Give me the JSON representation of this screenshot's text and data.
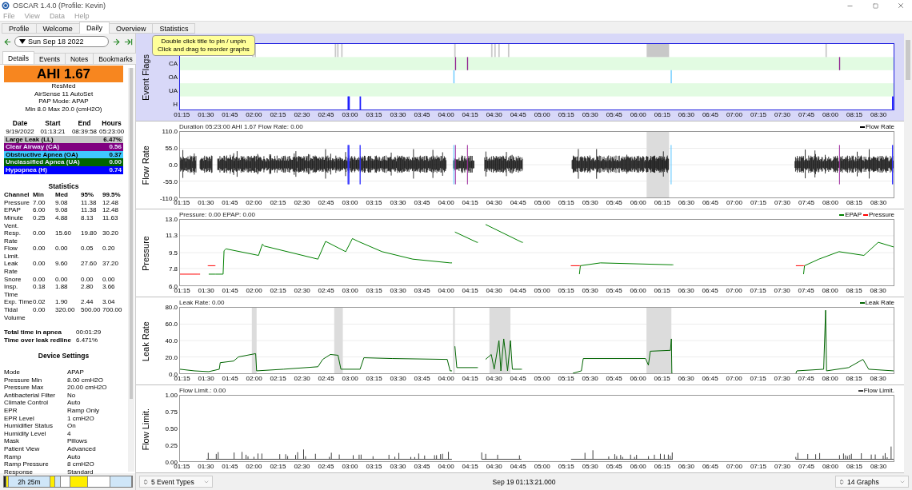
{
  "window": {
    "title": "OSCAR 1.4.0 (Profile: Kevin)"
  },
  "menu": [
    "File",
    "View",
    "Data",
    "Help"
  ],
  "tabs": [
    {
      "label": "Profile",
      "selected": false
    },
    {
      "label": "Welcome",
      "selected": false
    },
    {
      "label": "Daily",
      "selected": true
    },
    {
      "label": "Overview",
      "selected": false
    },
    {
      "label": "Statistics",
      "selected": false
    }
  ],
  "date_nav": {
    "date": "Sun Sep 18 2022"
  },
  "side_tabs": [
    {
      "label": "Details",
      "selected": true
    },
    {
      "label": "Events",
      "selected": false
    },
    {
      "label": "Notes",
      "selected": false
    },
    {
      "label": "Bookmarks",
      "selected": false
    }
  ],
  "summary": {
    "ahi": "AHI 1.67",
    "lines": [
      "ResMed",
      "AirSense 11 AutoSet",
      "PAP Mode: APAP",
      "Min 8.0 Max 20.0 (cmH2O)"
    ]
  },
  "session": {
    "columns": [
      "Date",
      "Start",
      "End",
      "Hours"
    ],
    "values": [
      "9/19/2022",
      "01:13:21",
      "08:39:58",
      "05:23:00"
    ]
  },
  "event_indices": [
    {
      "name": "Large Leak (LL)",
      "value": "6.47%",
      "color": "#c8c8c8"
    },
    {
      "name": "Clear Airway (CA)",
      "value": "0.56",
      "color": "#800080"
    },
    {
      "name": "Obstructive Apnea (OA)",
      "value": "0.37",
      "color": "#40c8ff"
    },
    {
      "name": "Unclassified Apnea (UA)",
      "value": "0.00",
      "color": "#006400"
    },
    {
      "name": "Hypopnea (H)",
      "value": "0.74",
      "color": "#0000ff"
    }
  ],
  "statistics": {
    "title": "Statistics",
    "columns": [
      "Channel",
      "Min",
      "Med",
      "95%",
      "99.5%"
    ],
    "rows": [
      [
        "Pressure",
        "7.00",
        "9.08",
        "11.38",
        "12.48"
      ],
      [
        "EPAP",
        "6.00",
        "9.08",
        "11.38",
        "12.48"
      ],
      [
        "Minute Vent.",
        "0.25",
        "4.88",
        "8.13",
        "11.63"
      ],
      [
        "Resp. Rate",
        "0.00",
        "15.60",
        "19.80",
        "30.20"
      ],
      [
        "Flow Limit.",
        "0.00",
        "0.00",
        "0.05",
        "0.20"
      ],
      [
        "Leak Rate",
        "0.00",
        "9.60",
        "27.60",
        "37.20"
      ],
      [
        "Snore",
        "0.00",
        "0.00",
        "0.00",
        "0.00"
      ],
      [
        "Insp. Time",
        "0.18",
        "1.88",
        "2.80",
        "3.66"
      ],
      [
        "Exp. Time",
        "0.02",
        "1.90",
        "2.44",
        "3.04"
      ],
      [
        "Tidal Volume",
        "0.00",
        "320.00",
        "500.00",
        "700.00"
      ]
    ]
  },
  "totals": [
    {
      "label": "Total time in apnea",
      "value": "00:01:29"
    },
    {
      "label": "Time over leak redline",
      "value": "6.471%"
    }
  ],
  "device_settings": {
    "title": "Device Settings",
    "rows": [
      {
        "label": "Mode",
        "value": "APAP"
      },
      {
        "label": "Pressure Min",
        "value": "8.00 cmH2O"
      },
      {
        "label": "Pressure Max",
        "value": "20.00 cmH2O"
      },
      {
        "label": "Antibacterial Filter",
        "value": "No"
      },
      {
        "label": "Climate Control",
        "value": "Auto"
      },
      {
        "label": "EPR",
        "value": "Ramp Only"
      },
      {
        "label": "EPR Level",
        "value": "1 cmH2O"
      },
      {
        "label": "Humidifier Status",
        "value": "On"
      },
      {
        "label": "Humidity Level",
        "value": "4"
      },
      {
        "label": "Mask",
        "value": "Pillows"
      },
      {
        "label": "Patient View",
        "value": "Advanced"
      },
      {
        "label": "Ramp",
        "value": "Auto"
      },
      {
        "label": "Ramp Pressure",
        "value": "8 cmH2O"
      },
      {
        "label": "Response",
        "value": "Standard"
      }
    ]
  },
  "timeline": {
    "label": "2h 25m"
  },
  "tooltip": {
    "lines": [
      "Double click title to pin / unpin",
      "Click and drag to reorder graphs"
    ]
  },
  "graphs": [
    {
      "kind": "flags",
      "axis_label": "Event Flags",
      "selected": true,
      "row_labels": [
        "CA",
        "OA",
        "UA",
        "H"
      ],
      "xticks": [
        "01:15",
        "01:30",
        "01:45",
        "02:00",
        "02:15",
        "02:30",
        "02:45",
        "03:00",
        "03:15",
        "03:30",
        "03:45",
        "04:00",
        "04:15",
        "04:30",
        "04:45",
        "05:00",
        "05:15",
        "05:30",
        "05:45",
        "06:00",
        "06:15",
        "06:30",
        "06:45",
        "07:00",
        "07:15",
        "07:30",
        "07:45",
        "08:00",
        "08:15",
        "08:30"
      ]
    },
    {
      "kind": "flow",
      "axis_label": "Flow Rate",
      "selected": false,
      "title": "Duration 05:23:00 AHI 1.67 Flow Rate: 0.00",
      "legend": [
        {
          "name": "Flow Rate",
          "color": "#000000"
        }
      ],
      "yticks": [
        "110.0",
        "55.0",
        "0.0",
        "-55.0",
        "-110.0"
      ],
      "xticks": [
        "01:15",
        "01:30",
        "01:45",
        "02:00",
        "02:15",
        "02:30",
        "02:45",
        "03:00",
        "03:15",
        "03:30",
        "03:45",
        "04:00",
        "04:15",
        "04:30",
        "04:45",
        "05:00",
        "05:15",
        "05:30",
        "05:45",
        "06:00",
        "06:15",
        "06:30",
        "06:45",
        "07:00",
        "07:15",
        "07:30",
        "07:45",
        "08:00",
        "08:15",
        "08:30"
      ]
    },
    {
      "kind": "pressure",
      "selected": false,
      "title": "Pressure: 0.00 EPAP: 0.00",
      "chart_data": {
        "type": "line",
        "ylabel": "Pressure",
        "xlim": [
          1.22,
          8.67
        ],
        "ylim": [
          6,
          13
        ],
        "grid": true,
        "legend": true,
        "yticks": [
          {
            "value": 13,
            "label": "13.0"
          },
          {
            "value": 11.3,
            "label": "11.3"
          },
          {
            "value": 9.5,
            "label": "9.5"
          },
          {
            "value": 7.8,
            "label": "7.8"
          },
          {
            "value": 6,
            "label": "6.0"
          }
        ],
        "xticks": [
          {
            "value": 1.25,
            "label": "01:15"
          },
          {
            "value": 1.5,
            "label": "01:30"
          },
          {
            "value": 1.75,
            "label": "01:45"
          },
          {
            "value": 2,
            "label": "02:00"
          },
          {
            "value": 2.25,
            "label": "02:15"
          },
          {
            "value": 2.5,
            "label": "02:30"
          },
          {
            "value": 2.75,
            "label": "02:45"
          },
          {
            "value": 3,
            "label": "03:00"
          },
          {
            "value": 3.25,
            "label": "03:15"
          },
          {
            "value": 3.5,
            "label": "03:30"
          },
          {
            "value": 3.75,
            "label": "03:45"
          },
          {
            "value": 4,
            "label": "04:00"
          },
          {
            "value": 4.25,
            "label": "04:15"
          },
          {
            "value": 4.5,
            "label": "04:30"
          },
          {
            "value": 4.75,
            "label": "04:45"
          },
          {
            "value": 5,
            "label": "05:00"
          },
          {
            "value": 5.25,
            "label": "05:15"
          },
          {
            "value": 5.5,
            "label": "05:30"
          },
          {
            "value": 5.75,
            "label": "05:45"
          },
          {
            "value": 6,
            "label": "06:00"
          },
          {
            "value": 6.25,
            "label": "06:15"
          },
          {
            "value": 6.5,
            "label": "06:30"
          },
          {
            "value": 6.75,
            "label": "06:45"
          },
          {
            "value": 7,
            "label": "07:00"
          },
          {
            "value": 7.25,
            "label": "07:15"
          },
          {
            "value": 7.5,
            "label": "07:30"
          },
          {
            "value": 7.75,
            "label": "07:45"
          },
          {
            "value": 8,
            "label": "08:00"
          },
          {
            "value": 8.25,
            "label": "08:15"
          },
          {
            "value": 8.5,
            "label": "08:30"
          }
        ],
        "x": [
          1.22,
          1.41,
          1.43,
          1.51,
          1.52,
          1.58,
          1.59,
          1.67,
          1.68,
          1.7,
          2.04,
          2.08,
          2.1,
          2.66,
          2.74,
          2.95,
          3.02,
          3.08,
          3.33,
          3.65,
          4.04,
          4.06,
          4.09,
          4.32,
          4.33,
          4.41,
          4.79,
          4.8,
          5.3,
          5.39,
          5.4,
          5.61,
          6.36,
          6.37,
          7.65,
          7.73,
          7.74,
          7.89,
          8.1,
          8.36,
          8.51,
          8.67
        ],
        "series": [
          {
            "name": "EPAP",
            "color": "#008000",
            "values": [
              null,
              null,
              null,
              null,
              7.2,
              7.2,
              7.2,
              7.2,
              9.7,
              9.9,
              9.2,
              10.4,
              10.2,
              8.8,
              10.7,
              9.6,
              11.0,
              10.7,
              9.6,
              8.8,
              8.4,
              null,
              11.7,
              10.6,
              null,
              12.5,
              10.6,
              null,
              null,
              7.2,
              8.1,
              8.4,
              8.2,
              null,
              null,
              7.2,
              8.1,
              8.8,
              9.6,
              9.2,
              10.6,
              10.1
            ]
          },
          {
            "name": "Pressure",
            "color": "#ff0000",
            "values": [
              7.2,
              7.2,
              null,
              8.1,
              8.1,
              8.1,
              null,
              null,
              null,
              null,
              null,
              null,
              null,
              null,
              null,
              null,
              null,
              null,
              null,
              null,
              null,
              null,
              null,
              null,
              null,
              null,
              null,
              null,
              8.1,
              8.1,
              null,
              null,
              null,
              null,
              8.1,
              8.1,
              null,
              null,
              null,
              null,
              null,
              null
            ]
          }
        ]
      }
    },
    {
      "kind": "leak",
      "selected": false,
      "title": "Leak Rate: 0.00",
      "chart_data": {
        "type": "line",
        "ylabel": "Leak Rate",
        "xlim": [
          1.22,
          8.67
        ],
        "ylim": [
          0,
          80
        ],
        "grid": true,
        "legend": true,
        "bands": [
          {
            "axis": "x",
            "from": 1.97,
            "to": 2.02,
            "color": "#dcdcdc"
          },
          {
            "axis": "x",
            "from": 2.83,
            "to": 2.92,
            "color": "#dcdcdc"
          },
          {
            "axis": "x",
            "from": 4.07,
            "to": 4.09,
            "color": "#dcdcdc"
          },
          {
            "axis": "x",
            "from": 4.45,
            "to": 4.67,
            "color": "#dcdcdc"
          },
          {
            "axis": "x",
            "from": 6.09,
            "to": 6.35,
            "color": "#dcdcdc"
          }
        ],
        "yticks": [
          {
            "value": 80,
            "label": "80.0"
          },
          {
            "value": 60,
            "label": "60.0"
          },
          {
            "value": 40,
            "label": "40.0"
          },
          {
            "value": 20,
            "label": "20.0"
          },
          {
            "value": 0,
            "label": "0.0"
          }
        ],
        "xticks": [
          {
            "value": 1.25,
            "label": "01:15"
          },
          {
            "value": 1.5,
            "label": "01:30"
          },
          {
            "value": 1.75,
            "label": "01:45"
          },
          {
            "value": 2,
            "label": "02:00"
          },
          {
            "value": 2.25,
            "label": "02:15"
          },
          {
            "value": 2.5,
            "label": "02:30"
          },
          {
            "value": 2.75,
            "label": "02:45"
          },
          {
            "value": 3,
            "label": "03:00"
          },
          {
            "value": 3.25,
            "label": "03:15"
          },
          {
            "value": 3.5,
            "label": "03:30"
          },
          {
            "value": 3.75,
            "label": "03:45"
          },
          {
            "value": 4,
            "label": "04:00"
          },
          {
            "value": 4.25,
            "label": "04:15"
          },
          {
            "value": 4.5,
            "label": "04:30"
          },
          {
            "value": 4.75,
            "label": "04:45"
          },
          {
            "value": 5,
            "label": "05:00"
          },
          {
            "value": 5.25,
            "label": "05:15"
          },
          {
            "value": 5.5,
            "label": "05:30"
          },
          {
            "value": 5.75,
            "label": "05:45"
          },
          {
            "value": 6,
            "label": "06:00"
          },
          {
            "value": 6.25,
            "label": "06:15"
          },
          {
            "value": 6.5,
            "label": "06:30"
          },
          {
            "value": 6.75,
            "label": "06:45"
          },
          {
            "value": 7,
            "label": "07:00"
          },
          {
            "value": 7.25,
            "label": "07:15"
          },
          {
            "value": 7.5,
            "label": "07:30"
          },
          {
            "value": 7.75,
            "label": "07:45"
          },
          {
            "value": 8,
            "label": "08:00"
          },
          {
            "value": 8.25,
            "label": "08:15"
          },
          {
            "value": 8.5,
            "label": "08:30"
          }
        ],
        "x": [
          1.22,
          1.37,
          1.52,
          1.63,
          1.64,
          1.78,
          1.83,
          2.01,
          2.02,
          2.3,
          2.66,
          2.71,
          2.79,
          2.87,
          2.9,
          3.1,
          3.14,
          3.44,
          4.01,
          4.04,
          4.06,
          4.09,
          4.11,
          4.32,
          4.33,
          4.41,
          4.47,
          4.5,
          4.55,
          4.57,
          4.6,
          4.64,
          4.67,
          4.69,
          4.78,
          4.79,
          5.32,
          5.41,
          5.43,
          6.08,
          6.11,
          6.13,
          6.34,
          6.35,
          6.355,
          6.36,
          7.65,
          7.66,
          7.94,
          7.96,
          7.97,
          8.2,
          8.35,
          8.41,
          8.67
        ],
        "series": [
          {
            "name": "Leak Rate",
            "color": "#006400",
            "values": [
              5,
              3,
              2,
              5,
              13,
              15,
              20,
              24,
              3,
              5,
              8,
              17,
              23,
              22,
              5,
              5,
              19,
              18,
              17,
              3,
              null,
              33,
              7,
              7,
              null,
              17,
              23,
              5,
              40,
              3,
              42,
              3,
              40,
              5,
              5,
              null,
              0,
              3,
              18,
              18,
              10,
              27,
              28,
              42,
              0,
              null,
              0,
              3,
              5,
              77,
              3,
              7,
              17,
              5,
              3
            ]
          }
        ]
      }
    },
    {
      "kind": "flowlimit",
      "axis_label": "Flow Limit.",
      "selected": false,
      "title": "Flow Limit.: 0.00",
      "legend": [
        {
          "name": "Flow Limit.",
          "color": "#404040"
        }
      ],
      "yticks": [
        "1.00",
        "0.75",
        "0.50",
        "0.25",
        "0.00"
      ],
      "xticks": [
        "01:15",
        "01:30",
        "01:45",
        "02:00",
        "02:15",
        "02:30",
        "02:45",
        "03:00",
        "03:15",
        "03:30",
        "03:45",
        "04:00",
        "04:15",
        "04:30",
        "04:45",
        "05:00",
        "05:15",
        "05:30",
        "05:45",
        "06:00",
        "06:15",
        "06:30",
        "06:45",
        "07:00",
        "07:15",
        "07:30",
        "07:45",
        "08:00",
        "08:15",
        "08:30"
      ]
    }
  ],
  "bottom_bar": {
    "event_types": "5 Event Types",
    "time": "Sep 19 01:13:21.000",
    "graphs": "14 Graphs"
  }
}
